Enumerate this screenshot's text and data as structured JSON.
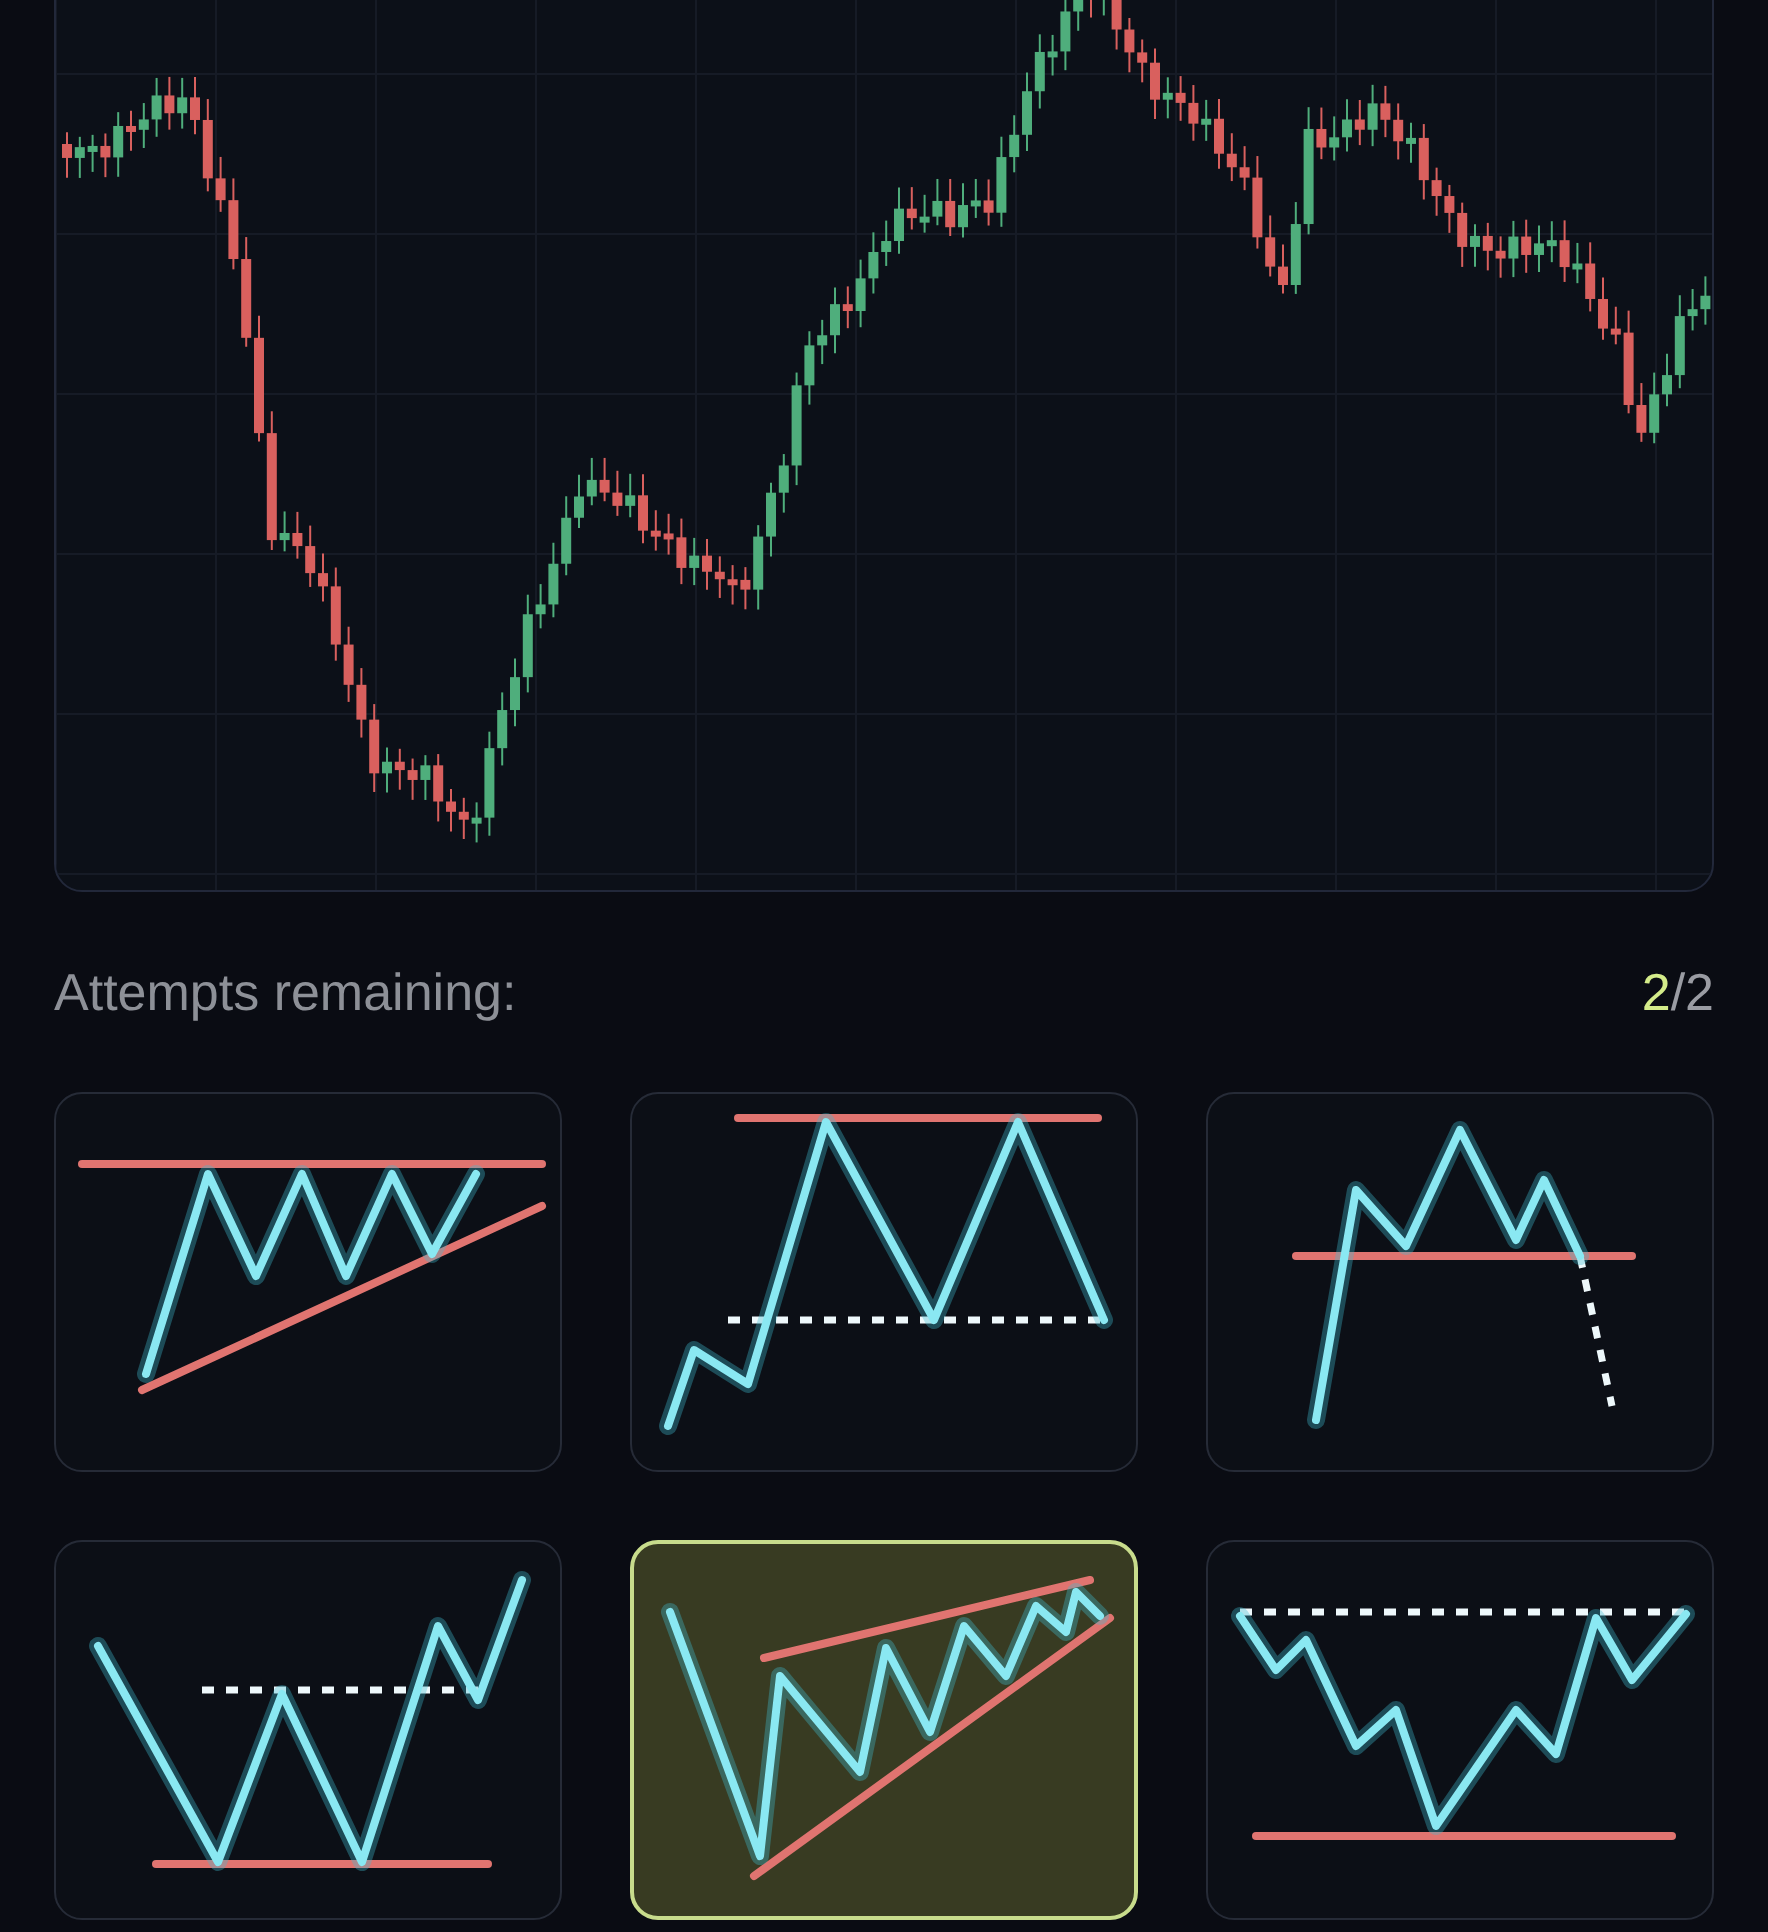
{
  "attempts": {
    "label": "Attempts remaining:",
    "remaining": "2",
    "total": "/2"
  },
  "patterns": [
    {
      "kind": "ascending-triangle",
      "selected": false
    },
    {
      "kind": "double-top",
      "selected": false
    },
    {
      "kind": "head-and-shoulders",
      "selected": false
    },
    {
      "kind": "double-bottom",
      "selected": false
    },
    {
      "kind": "rising-wedge",
      "selected": true
    },
    {
      "kind": "inverse-head-and-shoulders",
      "selected": false
    }
  ]
}
